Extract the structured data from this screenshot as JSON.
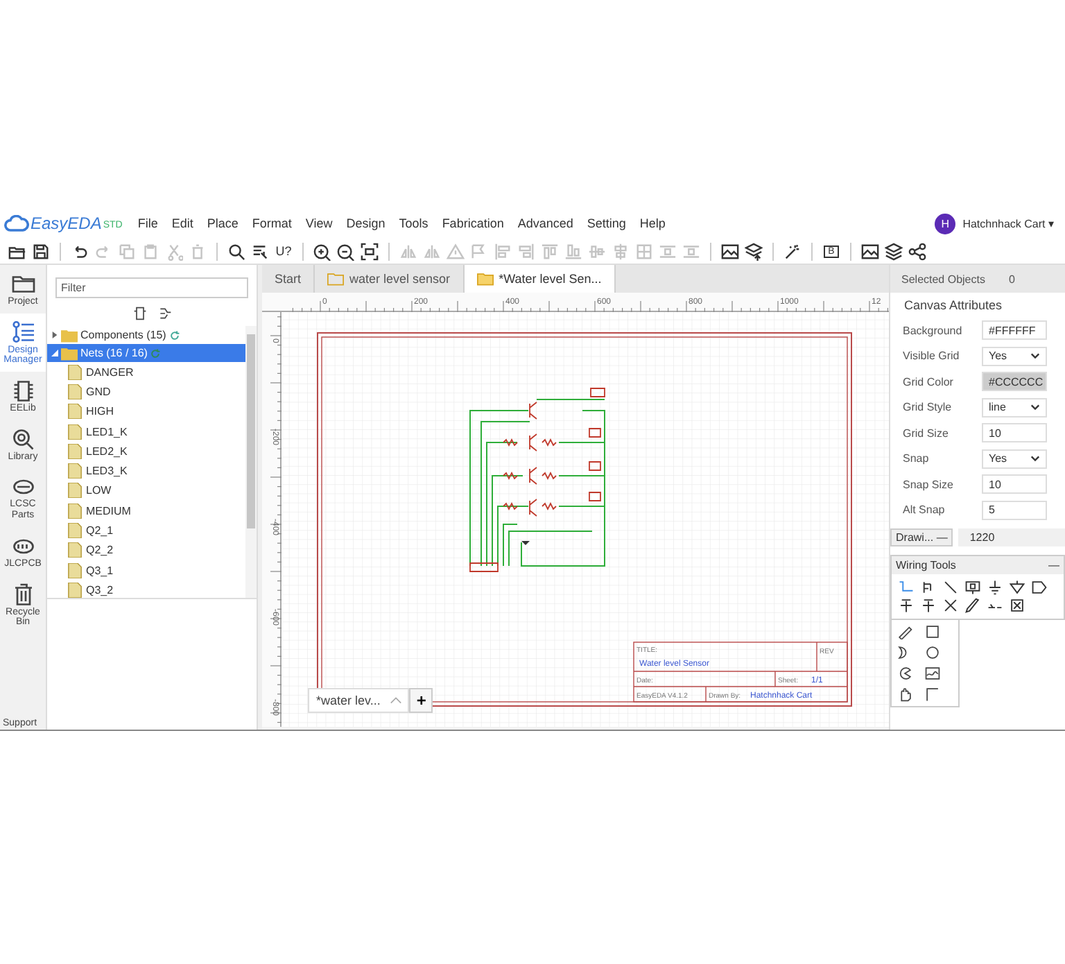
{
  "app": {
    "logo": "EasyEDA",
    "edition": "STD"
  },
  "menu": [
    "File",
    "Edit",
    "Place",
    "Format",
    "View",
    "Design",
    "Tools",
    "Fabrication",
    "Advanced",
    "Setting",
    "Help"
  ],
  "user": {
    "initial": "H",
    "name": "Hatchnhack Cart ▾"
  },
  "toolbar": [
    [
      {
        "kind": "open",
        "disabled": false
      },
      {
        "kind": "save",
        "disabled": false
      }
    ],
    [
      {
        "kind": "undo",
        "disabled": false
      },
      {
        "kind": "redo",
        "disabled": true
      },
      {
        "kind": "copy",
        "disabled": true
      },
      {
        "kind": "paste",
        "disabled": true
      },
      {
        "kind": "cut",
        "disabled": true
      },
      {
        "kind": "delete",
        "disabled": true
      }
    ],
    [
      {
        "kind": "search",
        "disabled": false
      },
      {
        "kind": "find",
        "disabled": false
      },
      {
        "kind": "annotate",
        "disabled": false,
        "label": "U?"
      }
    ],
    [
      {
        "kind": "zoom-in",
        "disabled": false
      },
      {
        "kind": "zoom-out",
        "disabled": false
      },
      {
        "kind": "fit",
        "disabled": false
      }
    ],
    [
      {
        "kind": "flip",
        "disabled": true
      },
      {
        "kind": "flip",
        "disabled": true
      },
      {
        "kind": "warn",
        "disabled": true
      },
      {
        "kind": "flag",
        "disabled": true
      },
      {
        "kind": "align-left",
        "disabled": true
      },
      {
        "kind": "align-right",
        "disabled": true
      },
      {
        "kind": "align-top",
        "disabled": true
      },
      {
        "kind": "align-bottom",
        "disabled": true
      },
      {
        "kind": "align-middle",
        "disabled": true
      },
      {
        "kind": "align-center",
        "disabled": true
      },
      {
        "kind": "grid",
        "disabled": true
      },
      {
        "kind": "distribute",
        "disabled": true
      },
      {
        "kind": "distribute",
        "disabled": true
      }
    ],
    [
      {
        "kind": "image",
        "disabled": false
      },
      {
        "kind": "layers-up",
        "disabled": false
      }
    ],
    [
      {
        "kind": "wand",
        "disabled": false
      }
    ],
    [
      {
        "kind": "boxed",
        "disabled": false,
        "label": "B"
      }
    ],
    [
      {
        "kind": "image",
        "disabled": false
      },
      {
        "kind": "layers",
        "disabled": false
      },
      {
        "kind": "share",
        "disabled": false
      }
    ]
  ],
  "rail": [
    {
      "kind": "folder",
      "label": "Project",
      "selected": false
    },
    {
      "kind": "list",
      "label": "Design Manager",
      "selected": true
    },
    {
      "kind": "chip",
      "label": "EELib",
      "selected": false
    },
    {
      "kind": "lens",
      "label": "Library",
      "selected": false
    },
    {
      "kind": "lcsc",
      "label": "LCSC Parts",
      "selected": false
    },
    {
      "kind": "jlc",
      "label": "JLCPCB",
      "selected": false
    },
    {
      "kind": "trash",
      "label": "Recycle Bin",
      "selected": false
    }
  ],
  "support": "Support",
  "design_manager": {
    "filter_placeholder": "Filter",
    "tree": [
      {
        "label": "Components (15)",
        "expanded": false,
        "selected": false
      },
      {
        "label": "Nets (16 / 16)",
        "expanded": true,
        "selected": true,
        "children": [
          {
            "label": "DANGER"
          },
          {
            "label": "GND"
          },
          {
            "label": "HIGH"
          },
          {
            "label": "LED1_K"
          },
          {
            "label": "LED2_K"
          },
          {
            "label": "LED3_K"
          },
          {
            "label": "LOW"
          },
          {
            "label": "MEDIUM"
          },
          {
            "label": "Q2_1"
          },
          {
            "label": "Q2_2"
          },
          {
            "label": "Q3_1"
          },
          {
            "label": "Q3_2"
          }
        ]
      }
    ]
  },
  "tabs": [
    {
      "label": "Start",
      "folder": false,
      "selected": false
    },
    {
      "label": "water level sensor",
      "folder": true,
      "selected": false
    },
    {
      "label": "*Water level Sen...",
      "folder": true,
      "selected": true
    }
  ],
  "canvas": {
    "xticks": [
      "0",
      "200",
      "400",
      "600",
      "800",
      "1000",
      "12"
    ],
    "yticks": [
      "0",
      "-200",
      "-400",
      "-600",
      "-800"
    ],
    "title_block": {
      "title_caption": "TITLE:",
      "title": "Water level Sensor",
      "rev_caption": "REV",
      "date_caption": "Date:",
      "sheet_caption": "Sheet:",
      "sheet": "1/1",
      "version": "EasyEDA V4.1.2",
      "drawn_caption": "Drawn By:",
      "drawn_by": "Hatchnhack Cart"
    },
    "sheet_tab": "*water lev...",
    "add_sheet": "+"
  },
  "properties": {
    "selected_objects_label": "Selected Objects",
    "selected_objects": "0",
    "section": "Canvas Attributes",
    "rows": [
      {
        "label": "Background",
        "kind": "input",
        "value": "#FFFFFF"
      },
      {
        "label": "Visible Grid",
        "kind": "select",
        "value": "Yes"
      },
      {
        "label": "Grid Color",
        "kind": "color",
        "value": "#CCCCCC"
      },
      {
        "label": "Grid Style",
        "kind": "select",
        "value": "line"
      },
      {
        "label": "Grid Size",
        "kind": "input",
        "value": "10"
      },
      {
        "label": "Snap",
        "kind": "select",
        "value": "Yes"
      },
      {
        "label": "Snap Size",
        "kind": "input",
        "value": "10"
      },
      {
        "label": "Alt Snap",
        "kind": "input",
        "value": "5"
      }
    ]
  },
  "drawing_tools": {
    "title": "Drawi...",
    "minimize": "—",
    "coordinate": "1220"
  },
  "wiring_tools": {
    "title": "Wiring Tools",
    "minimize": "—",
    "tools": [
      {
        "kind": "wire",
        "selected": true
      },
      {
        "kind": "bus",
        "selected": false
      },
      {
        "kind": "line",
        "selected": false
      },
      {
        "kind": "netlabel",
        "selected": false
      },
      {
        "kind": "ground",
        "selected": false
      },
      {
        "kind": "gnd2",
        "selected": false
      },
      {
        "kind": "port",
        "selected": false
      },
      {
        "kind": "vcc",
        "selected": false
      },
      {
        "kind": "vcc",
        "selected": false
      },
      {
        "kind": "noconnect",
        "selected": false
      },
      {
        "kind": "probe",
        "selected": false
      },
      {
        "kind": "pin",
        "selected": false
      },
      {
        "kind": "group",
        "selected": false
      }
    ]
  }
}
